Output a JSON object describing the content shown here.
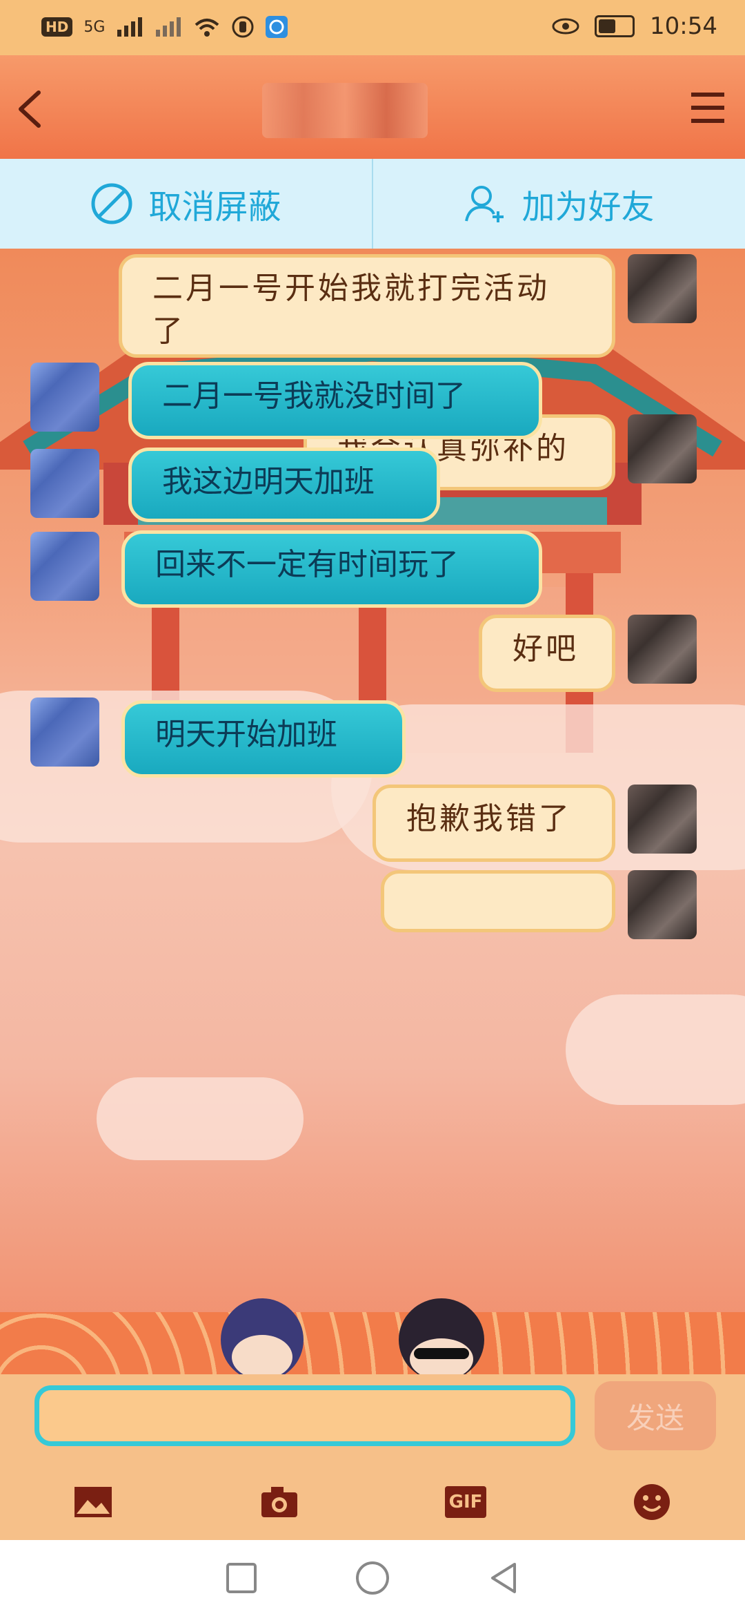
{
  "status_bar": {
    "left_badge": "HD",
    "network": "5G",
    "time": "10:54"
  },
  "header": {
    "title": ""
  },
  "actions": {
    "unblock_label": "取消屏蔽",
    "add_friend_label": "加为好友"
  },
  "messages": [
    {
      "side": "out",
      "text": "二月一号开始我就打完活动了"
    },
    {
      "side": "out",
      "text": "我会认真弥补的"
    },
    {
      "side": "in",
      "text": "二月一号我就没时间了"
    },
    {
      "side": "in",
      "text": "我这边明天加班"
    },
    {
      "side": "in",
      "text": "回来不一定有时间玩了"
    },
    {
      "side": "out",
      "text": "好吧"
    },
    {
      "side": "in",
      "text": "明天开始加班"
    },
    {
      "side": "out",
      "text": "抱歉我错了"
    }
  ],
  "input": {
    "value": "",
    "send_label": "发送"
  },
  "toolbar": {
    "gif_label": "GIF"
  },
  "colors": {
    "accent": "#20a8d8",
    "header": "#f07448",
    "bubble_in": "#19a9bf",
    "bubble_out": "#fde9c4"
  }
}
